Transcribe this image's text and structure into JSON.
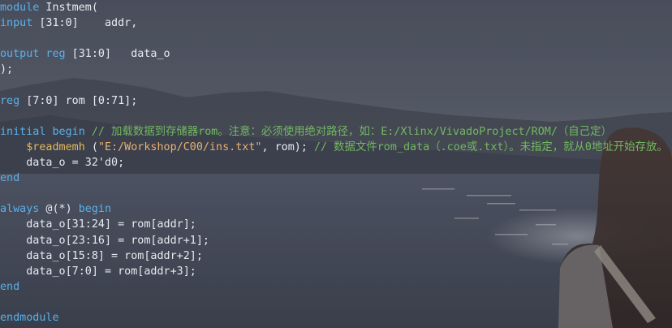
{
  "editor": {
    "language": "verilog",
    "theme": {
      "keyword_color": "#5ab0e8",
      "comment_color": "#72b860",
      "text_color": "#e8eaf0",
      "string_color": "#eab070",
      "system_task_color": "#e6b85c"
    },
    "lines": [
      [
        {
          "k": "kw",
          "t": "module"
        },
        {
          "k": "tx",
          "t": " Instmem("
        }
      ],
      [
        {
          "k": "kw",
          "t": "input"
        },
        {
          "k": "tx",
          "t": " [31:0]    addr,"
        }
      ],
      [],
      [
        {
          "k": "kw",
          "t": "output reg"
        },
        {
          "k": "tx",
          "t": " [31:0]   data_o"
        }
      ],
      [
        {
          "k": "tx",
          "t": ");"
        }
      ],
      [],
      [
        {
          "k": "kw",
          "t": "reg"
        },
        {
          "k": "tx",
          "t": " [7:0] rom [0:71];"
        }
      ],
      [],
      [
        {
          "k": "kw",
          "t": "initial begin"
        },
        {
          "k": "cm",
          "t": " // 加载数据到存储器rom。注意：必须使用绝对路径，如：E:/Xlinx/VivadoProject/ROM/（自己定）"
        }
      ],
      [
        {
          "k": "tx",
          "t": "    "
        },
        {
          "k": "sys",
          "t": "$readmemh"
        },
        {
          "k": "tx",
          "t": " ("
        },
        {
          "k": "str",
          "t": "\"E:/Workshop/C00/ins.txt\""
        },
        {
          "k": "tx",
          "t": ", rom); "
        },
        {
          "k": "cm",
          "t": "// 数据文件rom_data（.coe或.txt）。未指定，就从0地址开始存放。"
        }
      ],
      [
        {
          "k": "tx",
          "t": "    data_o = 32'd0;"
        }
      ],
      [
        {
          "k": "kw",
          "t": "end"
        }
      ],
      [],
      [
        {
          "k": "kw",
          "t": "always"
        },
        {
          "k": "tx",
          "t": " @(*) "
        },
        {
          "k": "kw",
          "t": "begin"
        }
      ],
      [
        {
          "k": "tx",
          "t": "    data_o[31:24] = rom[addr];"
        }
      ],
      [
        {
          "k": "tx",
          "t": "    data_o[23:16] = rom[addr+1];"
        }
      ],
      [
        {
          "k": "tx",
          "t": "    data_o[15:8] = rom[addr+2];"
        }
      ],
      [
        {
          "k": "tx",
          "t": "    data_o[7:0] = rom[addr+3];"
        }
      ],
      [
        {
          "k": "kw",
          "t": "end"
        }
      ],
      [],
      [
        {
          "k": "kw",
          "t": "endmodule"
        }
      ]
    ]
  }
}
